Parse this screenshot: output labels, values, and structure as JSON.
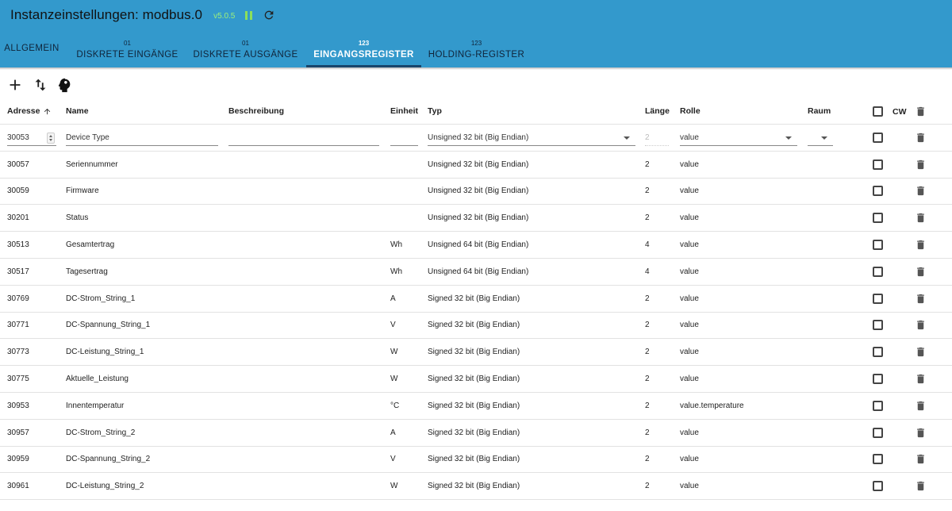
{
  "app": {
    "title": "Instanzeinstellungen: modbus.0",
    "version": "v5.0.5"
  },
  "tabs": [
    {
      "count": "",
      "label": "ALLGEMEIN"
    },
    {
      "count": "01",
      "label": "DISKRETE EINGÄNGE"
    },
    {
      "count": "01",
      "label": "DISKRETE AUSGÄNGE"
    },
    {
      "count": "123",
      "label": "EINGANGSREGISTER"
    },
    {
      "count": "123",
      "label": "HOLDING-REGISTER"
    }
  ],
  "active_tab": "EINGANGSREGISTER",
  "columns": {
    "address": "Adresse",
    "name": "Name",
    "description": "Beschreibung",
    "unit": "Einheit",
    "type": "Typ",
    "length": "Länge",
    "role": "Rolle",
    "room": "Raum",
    "cw": "CW"
  },
  "editing_row": {
    "address": "30053",
    "name": "Device Type",
    "description": "",
    "unit": "",
    "type": "Unsigned 32 bit (Big Endian)",
    "length": "2",
    "role": "value",
    "room": ""
  },
  "rows": [
    {
      "address": "30057",
      "name": "Seriennummer",
      "unit": "",
      "type": "Unsigned 32 bit (Big Endian)",
      "length": "2",
      "role": "value"
    },
    {
      "address": "30059",
      "name": "Firmware",
      "unit": "",
      "type": "Unsigned 32 bit (Big Endian)",
      "length": "2",
      "role": "value"
    },
    {
      "address": "30201",
      "name": "Status",
      "unit": "",
      "type": "Unsigned 32 bit (Big Endian)",
      "length": "2",
      "role": "value"
    },
    {
      "address": "30513",
      "name": "Gesamtertrag",
      "unit": "Wh",
      "type": "Unsigned 64 bit (Big Endian)",
      "length": "4",
      "role": "value"
    },
    {
      "address": "30517",
      "name": "Tagesertrag",
      "unit": "Wh",
      "type": "Unsigned 64 bit (Big Endian)",
      "length": "4",
      "role": "value"
    },
    {
      "address": "30769",
      "name": "DC-Strom_String_1",
      "unit": "A",
      "type": "Signed 32 bit (Big Endian)",
      "length": "2",
      "role": "value"
    },
    {
      "address": "30771",
      "name": "DC-Spannung_String_1",
      "unit": "V",
      "type": "Signed 32 bit (Big Endian)",
      "length": "2",
      "role": "value"
    },
    {
      "address": "30773",
      "name": "DC-Leistung_String_1",
      "unit": "W",
      "type": "Signed 32 bit (Big Endian)",
      "length": "2",
      "role": "value"
    },
    {
      "address": "30775",
      "name": "Aktuelle_Leistung",
      "unit": "W",
      "type": "Signed 32 bit (Big Endian)",
      "length": "2",
      "role": "value"
    },
    {
      "address": "30953",
      "name": "Innentemperatur",
      "unit": "°C",
      "type": "Signed 32 bit (Big Endian)",
      "length": "2",
      "role": "value.temperature"
    },
    {
      "address": "30957",
      "name": "DC-Strom_String_2",
      "unit": "A",
      "type": "Signed 32 bit (Big Endian)",
      "length": "2",
      "role": "value"
    },
    {
      "address": "30959",
      "name": "DC-Spannung_String_2",
      "unit": "V",
      "type": "Signed 32 bit (Big Endian)",
      "length": "2",
      "role": "value"
    },
    {
      "address": "30961",
      "name": "DC-Leistung_String_2",
      "unit": "W",
      "type": "Signed 32 bit (Big Endian)",
      "length": "2",
      "role": "value"
    }
  ],
  "icons": {
    "pause": "pause-icon",
    "reload": "reload-icon",
    "add": "add-icon",
    "sort": "sort-icon",
    "import": "import-icon",
    "delete": "trash-icon"
  },
  "colors": {
    "header_bg": "#3399cc",
    "version": "#9ef07a",
    "pause": "#8ce05a",
    "tab_indicator": "#19456b"
  }
}
